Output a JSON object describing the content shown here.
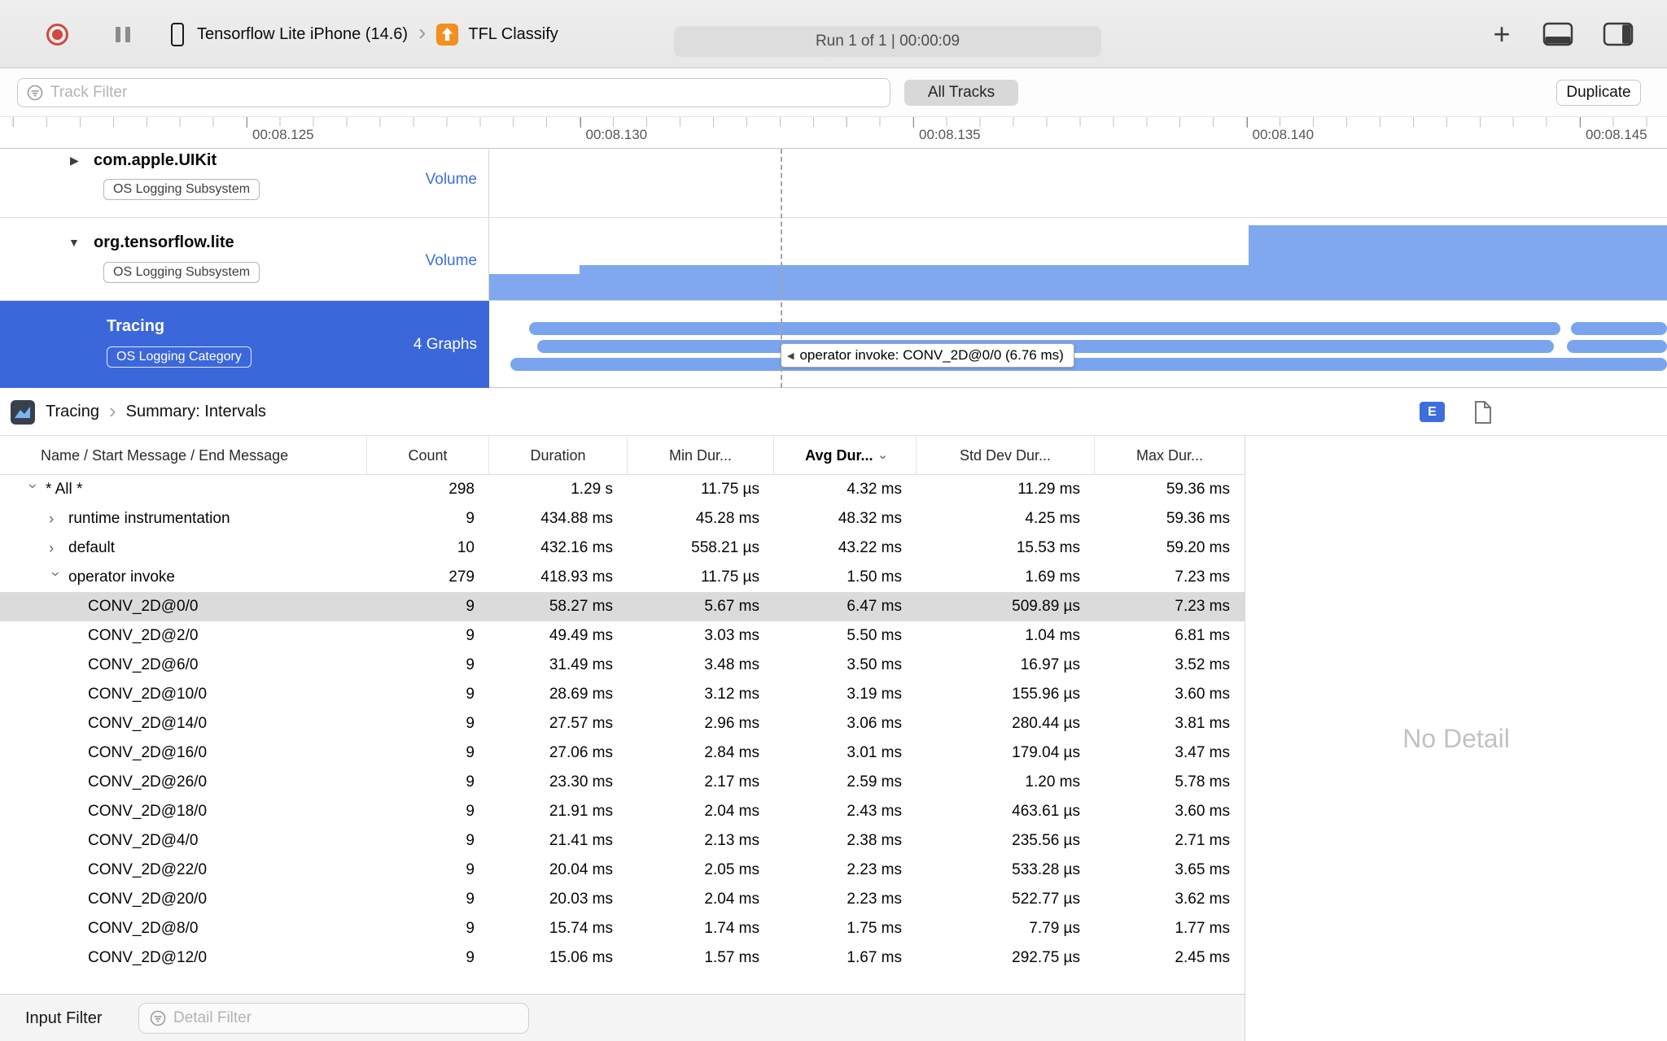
{
  "toolbar": {
    "device": "Tensorflow Lite iPhone (14.6)",
    "app": "TFL Classify",
    "run_info": "Run 1 of 1  |  00:00:09"
  },
  "filter_bar": {
    "track_filter_placeholder": "Track Filter",
    "all_tracks": "All Tracks",
    "duplicate": "Duplicate"
  },
  "ruler": {
    "labels": [
      "00:08.125",
      "00:08.130",
      "00:08.135",
      "00:08.140",
      "00:08.145"
    ]
  },
  "tracks": [
    {
      "name": "com.apple.UIKit",
      "badge": "OS Logging Subsystem",
      "meta": "Volume",
      "disclosure": "collapsed"
    },
    {
      "name": "org.tensorflow.lite",
      "badge": "OS Logging Subsystem",
      "meta": "Volume",
      "disclosure": "expanded"
    },
    {
      "name": "Tracing",
      "badge": "OS Logging Category",
      "meta": "4 Graphs",
      "selected": true
    }
  ],
  "timeline": {
    "tooltip": "operator invoke: CONV_2D@0/0 (6.76 ms)",
    "bar_color": "#7FA8EF",
    "selection_color": "#3B67DB"
  },
  "detail": {
    "breadcrumb": {
      "tool": "Tracing",
      "view": "Summary: Intervals"
    },
    "extended_detail_button": "E",
    "no_detail": "No Detail",
    "table": {
      "columns": [
        {
          "label": "Name / Start Message / End Message"
        },
        {
          "label": "Count"
        },
        {
          "label": "Duration"
        },
        {
          "label": "Min Dur..."
        },
        {
          "label": "Avg Dur...",
          "sorted": true
        },
        {
          "label": "Std Dev Dur..."
        },
        {
          "label": "Max Dur..."
        }
      ],
      "rows": [
        {
          "name": "* All *",
          "count": "298",
          "duration": "1.29 s",
          "min": "11.75 µs",
          "avg": "4.32 ms",
          "std": "11.29 ms",
          "max": "59.36 ms",
          "indent": 0,
          "chevron": "down"
        },
        {
          "name": "runtime instrumentation",
          "count": "9",
          "duration": "434.88 ms",
          "min": "45.28 ms",
          "avg": "48.32 ms",
          "std": "4.25 ms",
          "max": "59.36 ms",
          "indent": 1,
          "chevron": "right"
        },
        {
          "name": "default",
          "count": "10",
          "duration": "432.16 ms",
          "min": "558.21 µs",
          "avg": "43.22 ms",
          "std": "15.53 ms",
          "max": "59.20 ms",
          "indent": 1,
          "chevron": "right"
        },
        {
          "name": "operator invoke",
          "count": "279",
          "duration": "418.93 ms",
          "min": "11.75 µs",
          "avg": "1.50 ms",
          "std": "1.69 ms",
          "max": "7.23 ms",
          "indent": 1,
          "chevron": "down"
        },
        {
          "name": "CONV_2D@0/0",
          "count": "9",
          "duration": "58.27 ms",
          "min": "5.67 ms",
          "avg": "6.47 ms",
          "std": "509.89 µs",
          "max": "7.23 ms",
          "indent": 2,
          "selected": true
        },
        {
          "name": "CONV_2D@2/0",
          "count": "9",
          "duration": "49.49 ms",
          "min": "3.03 ms",
          "avg": "5.50 ms",
          "std": "1.04 ms",
          "max": "6.81 ms",
          "indent": 2
        },
        {
          "name": "CONV_2D@6/0",
          "count": "9",
          "duration": "31.49 ms",
          "min": "3.48 ms",
          "avg": "3.50 ms",
          "std": "16.97 µs",
          "max": "3.52 ms",
          "indent": 2
        },
        {
          "name": "CONV_2D@10/0",
          "count": "9",
          "duration": "28.69 ms",
          "min": "3.12 ms",
          "avg": "3.19 ms",
          "std": "155.96 µs",
          "max": "3.60 ms",
          "indent": 2
        },
        {
          "name": "CONV_2D@14/0",
          "count": "9",
          "duration": "27.57 ms",
          "min": "2.96 ms",
          "avg": "3.06 ms",
          "std": "280.44 µs",
          "max": "3.81 ms",
          "indent": 2
        },
        {
          "name": "CONV_2D@16/0",
          "count": "9",
          "duration": "27.06 ms",
          "min": "2.84 ms",
          "avg": "3.01 ms",
          "std": "179.04 µs",
          "max": "3.47 ms",
          "indent": 2
        },
        {
          "name": "CONV_2D@26/0",
          "count": "9",
          "duration": "23.30 ms",
          "min": "2.17 ms",
          "avg": "2.59 ms",
          "std": "1.20 ms",
          "max": "5.78 ms",
          "indent": 2
        },
        {
          "name": "CONV_2D@18/0",
          "count": "9",
          "duration": "21.91 ms",
          "min": "2.04 ms",
          "avg": "2.43 ms",
          "std": "463.61 µs",
          "max": "3.60 ms",
          "indent": 2
        },
        {
          "name": "CONV_2D@4/0",
          "count": "9",
          "duration": "21.41 ms",
          "min": "2.13 ms",
          "avg": "2.38 ms",
          "std": "235.56 µs",
          "max": "2.71 ms",
          "indent": 2
        },
        {
          "name": "CONV_2D@22/0",
          "count": "9",
          "duration": "20.04 ms",
          "min": "2.05 ms",
          "avg": "2.23 ms",
          "std": "533.28 µs",
          "max": "3.65 ms",
          "indent": 2
        },
        {
          "name": "CONV_2D@20/0",
          "count": "9",
          "duration": "20.03 ms",
          "min": "2.04 ms",
          "avg": "2.23 ms",
          "std": "522.77 µs",
          "max": "3.62 ms",
          "indent": 2
        },
        {
          "name": "CONV_2D@8/0",
          "count": "9",
          "duration": "15.74 ms",
          "min": "1.74 ms",
          "avg": "1.75 ms",
          "std": "7.79 µs",
          "max": "1.77 ms",
          "indent": 2
        },
        {
          "name": "CONV_2D@12/0",
          "count": "9",
          "duration": "15.06 ms",
          "min": "1.57 ms",
          "avg": "1.67 ms",
          "std": "292.75 µs",
          "max": "2.45 ms",
          "indent": 2
        }
      ]
    }
  },
  "bottom_bar": {
    "label": "Input Filter",
    "detail_filter_placeholder": "Detail Filter"
  }
}
